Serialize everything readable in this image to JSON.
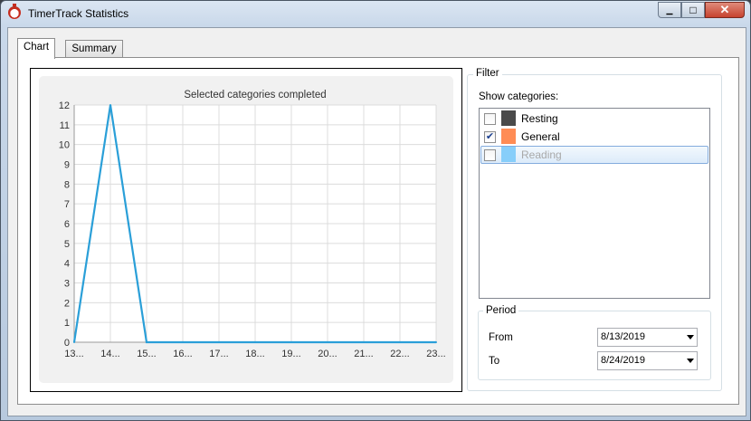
{
  "window": {
    "title": "TimerTrack Statistics",
    "minimize_glyph": "▁",
    "maximize_glyph": "□",
    "close_glyph": "✕"
  },
  "tabs": [
    {
      "label": "Chart",
      "active": true
    },
    {
      "label": "Summary",
      "active": false
    }
  ],
  "filter": {
    "title": "Filter",
    "show_label": "Show categories:",
    "categories": [
      {
        "label": "Resting",
        "checked": false,
        "color": "#4a4a4a"
      },
      {
        "label": "General",
        "checked": true,
        "color": "#ff8c55"
      },
      {
        "label": "Reading",
        "checked": false,
        "color": "#87cefa"
      }
    ],
    "checked_glyph": "✔"
  },
  "period": {
    "title": "Period",
    "from_label": "From",
    "from_value": "8/13/2019",
    "to_label": "To",
    "to_value": "8/24/2019"
  },
  "chart_data": {
    "type": "line",
    "title": "Selected categories completed",
    "xlabel": "",
    "ylabel": "",
    "x_ticks": [
      "13...",
      "14...",
      "15...",
      "16...",
      "17...",
      "18...",
      "19...",
      "20...",
      "21...",
      "22...",
      "23..."
    ],
    "ylim": [
      0,
      12
    ],
    "y_ticks": [
      "0",
      "1",
      "2",
      "3",
      "4",
      "5",
      "6",
      "7",
      "8",
      "9",
      "10",
      "11",
      "12"
    ],
    "grid": true,
    "series": [
      {
        "color": "#2a9fd8",
        "values": [
          0,
          12,
          0,
          0,
          0,
          0,
          0,
          0,
          0,
          0,
          0
        ]
      }
    ]
  }
}
